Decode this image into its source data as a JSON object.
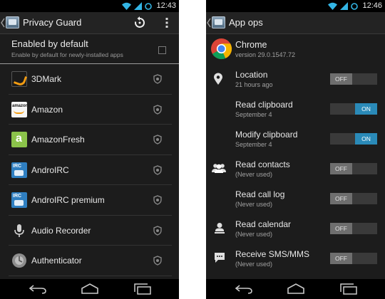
{
  "left_screen": {
    "status_time": "12:43",
    "title": "Privacy Guard",
    "enabled_by_default": {
      "title": "Enabled by default",
      "subtitle": "Enable by default for newly-installed apps",
      "checked": false
    },
    "apps": [
      {
        "name": "3DMark",
        "icon": "3dmark-icon"
      },
      {
        "name": "Amazon",
        "icon": "amazon-icon",
        "icon_text": "amazon"
      },
      {
        "name": "AmazonFresh",
        "icon": "amazonfresh-icon",
        "icon_text": "a"
      },
      {
        "name": "AndroIRC",
        "icon": "androirc-icon",
        "icon_text": "IRC"
      },
      {
        "name": "AndroIRC premium",
        "icon": "androirc-premium-icon",
        "icon_text": "IRC"
      },
      {
        "name": "Audio Recorder",
        "icon": "microphone-icon"
      },
      {
        "name": "Authenticator",
        "icon": "authenticator-icon"
      }
    ]
  },
  "right_screen": {
    "status_time": "12:46",
    "title": "App ops",
    "app": {
      "name": "Chrome",
      "version": "version 29.0.1547.72"
    },
    "ops": [
      {
        "title": "Location",
        "subtitle": "21 hours ago",
        "state": "OFF",
        "icon": "location-pin-icon"
      },
      {
        "title": "Read clipboard",
        "subtitle": "September 4",
        "state": "ON",
        "icon": ""
      },
      {
        "title": "Modify clipboard",
        "subtitle": "September 4",
        "state": "ON",
        "icon": ""
      },
      {
        "title": "Read contacts",
        "subtitle": "(Never used)",
        "state": "OFF",
        "icon": "contacts-icon"
      },
      {
        "title": "Read call log",
        "subtitle": "(Never used)",
        "state": "OFF",
        "icon": ""
      },
      {
        "title": "Read calendar",
        "subtitle": "(Never used)",
        "state": "OFF",
        "icon": "calendar-person-icon"
      },
      {
        "title": "Receive SMS/MMS",
        "subtitle": "(Never used)",
        "state": "OFF",
        "icon": "sms-icon"
      }
    ]
  },
  "colors": {
    "toggle_on": "#2a8ab8",
    "toggle_off": "#6e6e6e",
    "status_icons": "#33b5e5"
  }
}
